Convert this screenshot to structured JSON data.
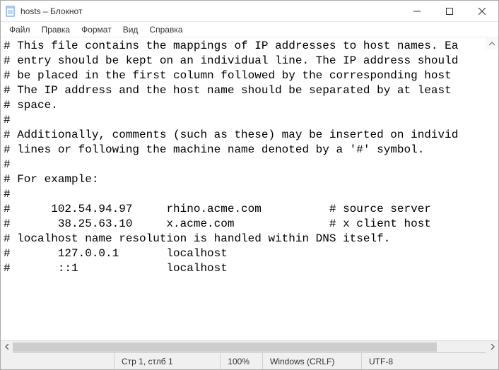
{
  "window": {
    "title": "hosts – Блокнот"
  },
  "menu": {
    "file": "Файл",
    "edit": "Правка",
    "format": "Формат",
    "view": "Вид",
    "help": "Справка"
  },
  "content": "# This file contains the mappings of IP addresses to host names. Ea\n# entry should be kept on an individual line. The IP address should\n# be placed in the first column followed by the corresponding host \n# The IP address and the host name should be separated by at least \n# space.\n#\n# Additionally, comments (such as these) may be inserted on individ\n# lines or following the machine name denoted by a '#' symbol.\n#\n# For example:\n#\n#      102.54.94.97     rhino.acme.com          # source server\n#       38.25.63.10     x.acme.com              # x client host\n# localhost name resolution is handled within DNS itself.\n#       127.0.0.1       localhost\n#       ::1             localhost",
  "status": {
    "position": "Стр 1, стлб 1",
    "zoom": "100%",
    "lineending": "Windows (CRLF)",
    "encoding": "UTF-8"
  }
}
